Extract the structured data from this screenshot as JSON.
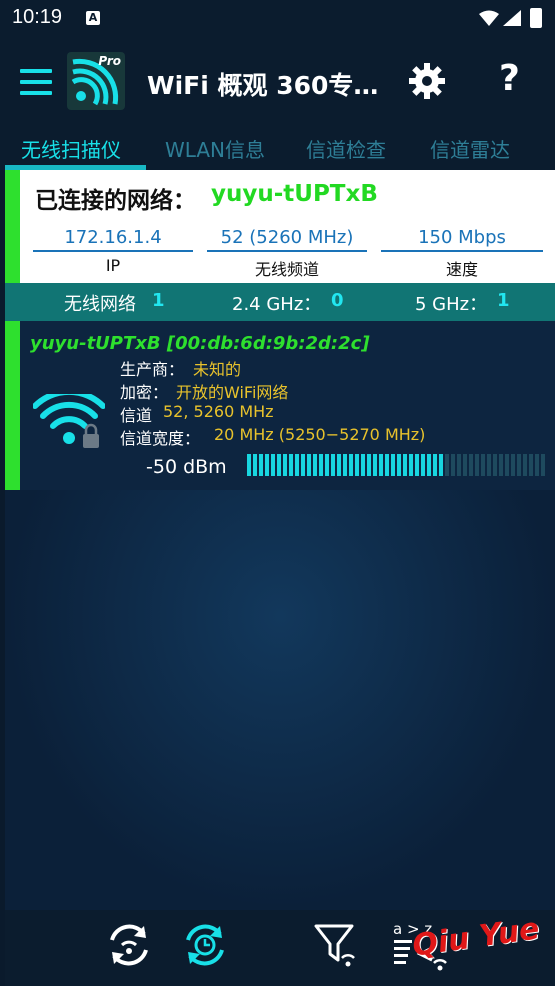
{
  "status_bar": {
    "time": "10:19",
    "notification_letter": "A"
  },
  "app_bar": {
    "title": "WiFi 概观 360专…",
    "logo_badge": "Pro"
  },
  "tabs": [
    {
      "label": "无线扫描仪",
      "active": true
    },
    {
      "label": "WLAN信息",
      "active": false
    },
    {
      "label": "信道检查",
      "active": false
    },
    {
      "label": "信道雷达",
      "active": false
    }
  ],
  "connected": {
    "label": "已连接的网络：",
    "ssid": "yuyu-tUPTxB",
    "ip": {
      "value": "172.16.1.4",
      "caption": "IP"
    },
    "channel": {
      "value": "52 (5260 MHz)",
      "caption": "无线频道"
    },
    "speed": {
      "value": "150 Mbps",
      "caption": "速度"
    }
  },
  "summary": {
    "networks_label": "无线网络",
    "networks_count": "1",
    "ghz24_label": "2.4 GHz：",
    "ghz24_count": "0",
    "ghz5_label": "5 GHz：",
    "ghz5_count": "1"
  },
  "network": {
    "title": "yuyu-tUPTxB [00:db:6d:9b:2d:2c]",
    "vendor_label": "生产商：",
    "vendor_value": "未知的",
    "security_label": "加密：",
    "security_value": "开放的WiFi网络",
    "channel_label": "信道",
    "channel_value": "52, 5260 MHz",
    "width_label": "信道宽度：",
    "width_value": "20 MHz (5250−5270 MHz)",
    "signal_text": "-50  dBm",
    "signal_fraction": 0.66
  },
  "toolbar": {
    "sort_label": "a > z",
    "watermark": "Qiu Yue"
  },
  "colors": {
    "accent": "#18e0e8",
    "connected_green": "#2ee02e",
    "summary_teal": "#117574",
    "value_yellow": "#e8c22c"
  }
}
